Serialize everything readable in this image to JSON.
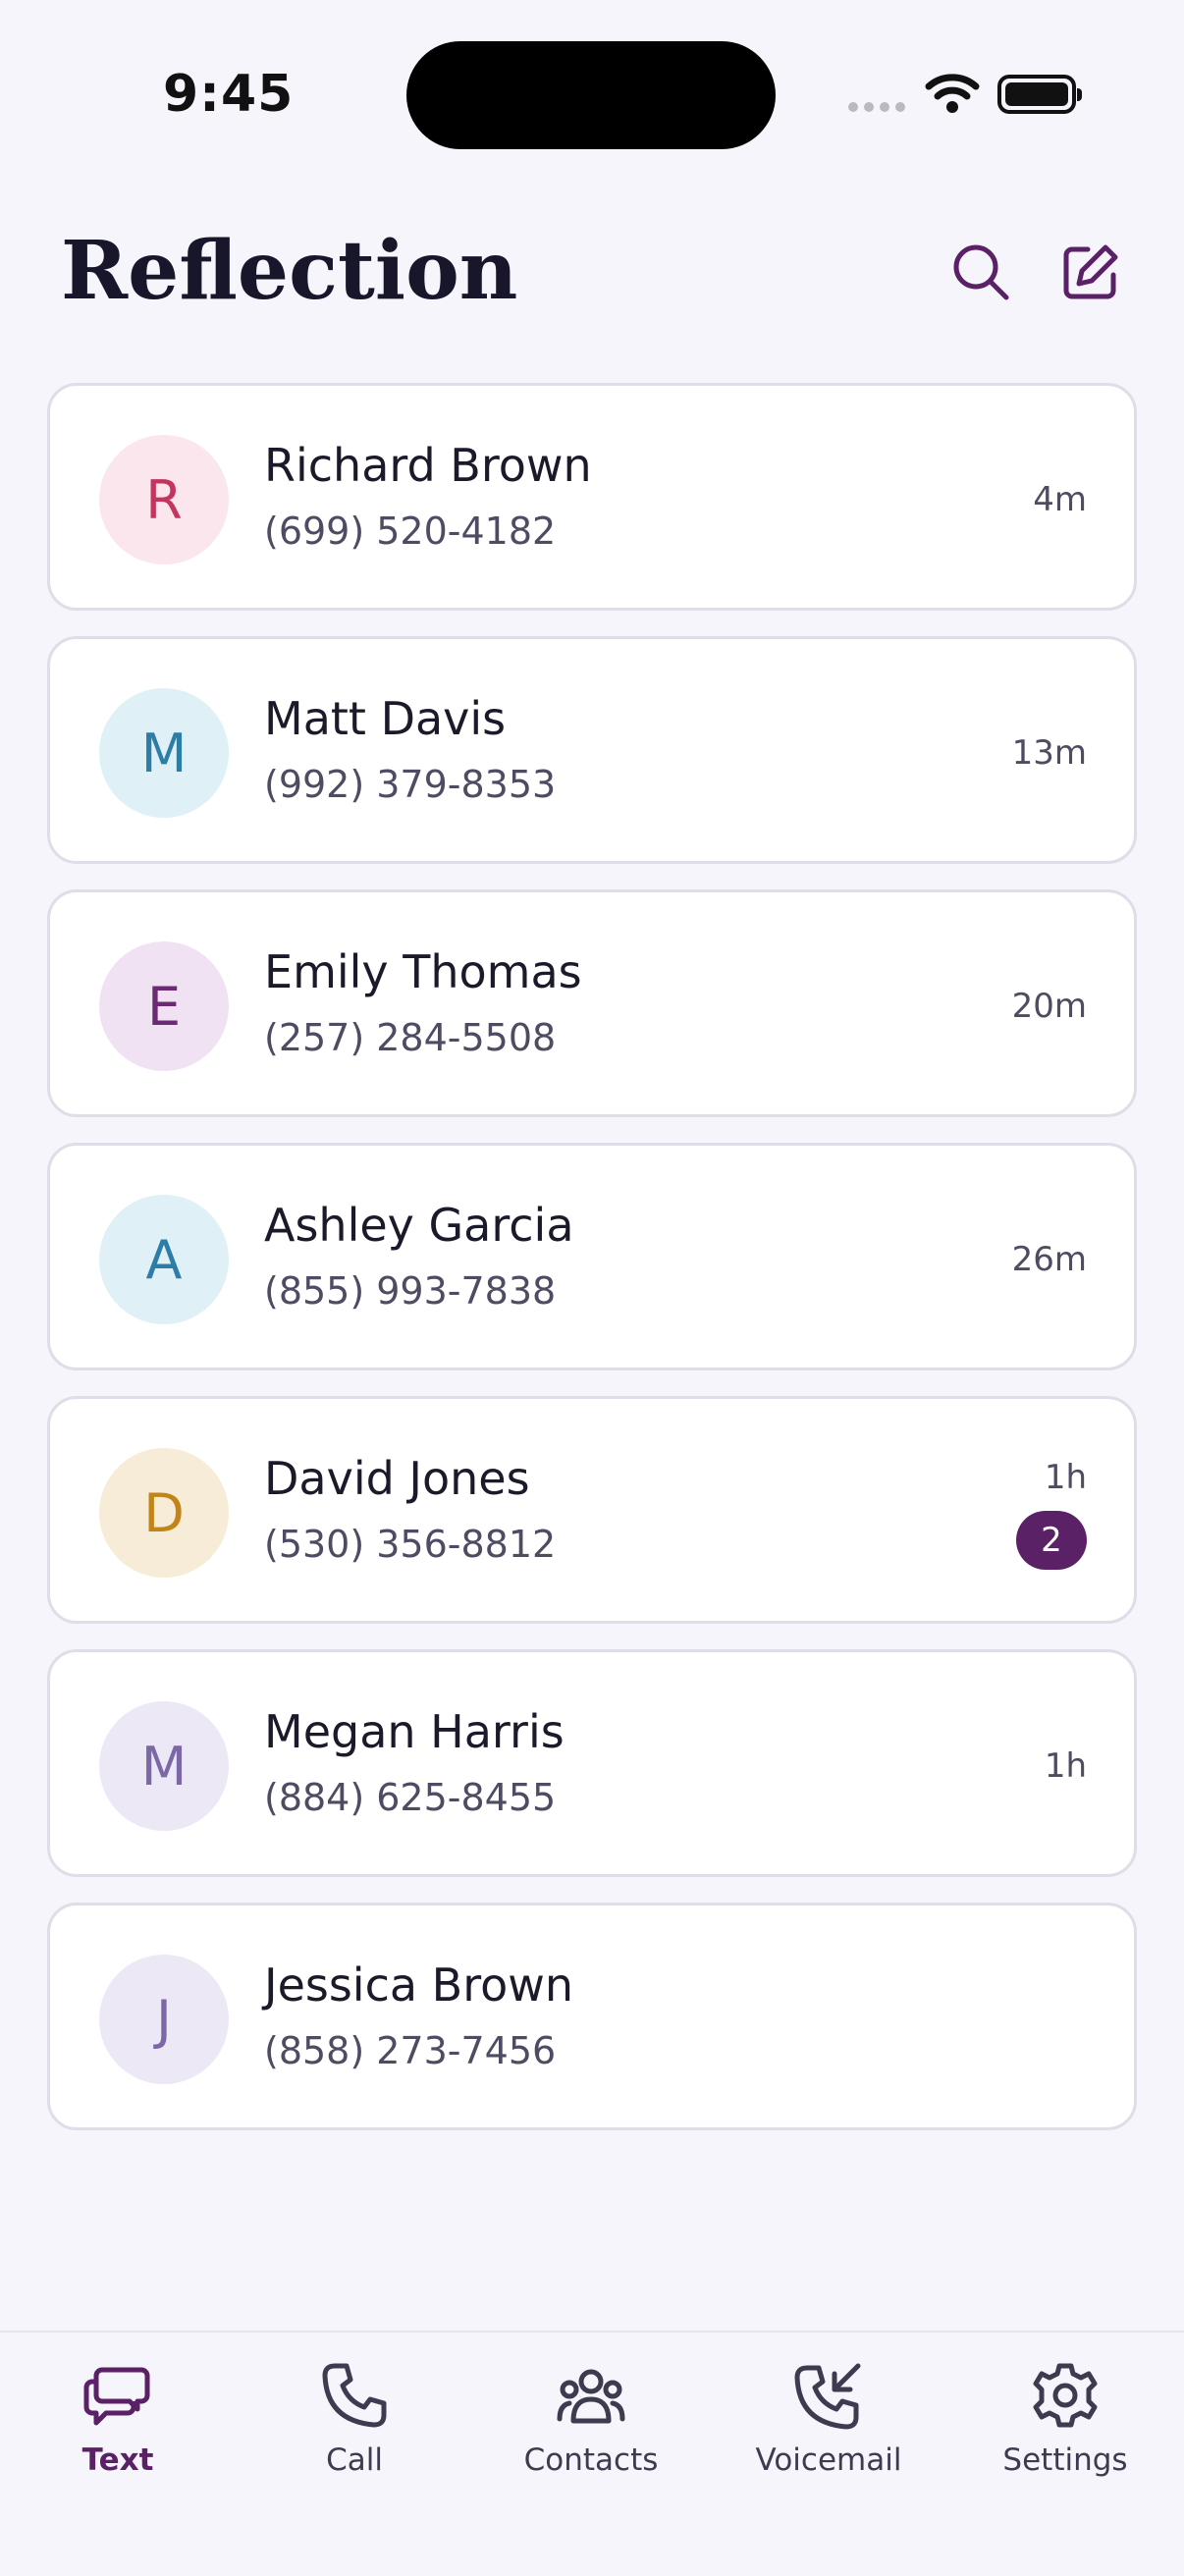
{
  "status": {
    "time": "9:45"
  },
  "header": {
    "title": "Reflection"
  },
  "conversations": [
    {
      "initial": "R",
      "name": "Richard Brown",
      "phone": "(699) 520-4182",
      "time": "4m",
      "badge": null,
      "avatar_bg": "#fbe6ee",
      "avatar_fg": "#c2355f"
    },
    {
      "initial": "M",
      "name": "Matt Davis",
      "phone": "(992) 379-8353",
      "time": "13m",
      "badge": null,
      "avatar_bg": "#dff0f6",
      "avatar_fg": "#2d7ea6"
    },
    {
      "initial": "E",
      "name": "Emily Thomas",
      "phone": "(257) 284-5508",
      "time": "20m",
      "badge": null,
      "avatar_bg": "#f1e2f3",
      "avatar_fg": "#6d2a74"
    },
    {
      "initial": "A",
      "name": "Ashley Garcia",
      "phone": "(855) 993-7838",
      "time": "26m",
      "badge": null,
      "avatar_bg": "#dff0f6",
      "avatar_fg": "#2d7ea6"
    },
    {
      "initial": "D",
      "name": "David Jones",
      "phone": "(530) 356-8812",
      "time": "1h",
      "badge": "2",
      "avatar_bg": "#f6ecd8",
      "avatar_fg": "#c28417"
    },
    {
      "initial": "M",
      "name": "Megan Harris",
      "phone": "(884) 625-8455",
      "time": "1h",
      "badge": null,
      "avatar_bg": "#ece8f5",
      "avatar_fg": "#7c68a6"
    },
    {
      "initial": "J",
      "name": "Jessica Brown",
      "phone": "(858) 273-7456",
      "time": "",
      "badge": null,
      "avatar_bg": "#ece8f5",
      "avatar_fg": "#7c68a6"
    }
  ],
  "tabs": [
    {
      "label": "Text",
      "icon": "chat-bubbles-icon",
      "active": true
    },
    {
      "label": "Call",
      "icon": "phone-icon",
      "active": false
    },
    {
      "label": "Contacts",
      "icon": "contacts-icon",
      "active": false
    },
    {
      "label": "Voicemail",
      "icon": "voicemail-incoming-icon",
      "active": false
    },
    {
      "label": "Settings",
      "icon": "gear-icon",
      "active": false
    }
  ],
  "colors": {
    "accent": "#5b2166",
    "background": "#f6f5fb",
    "card": "#ffffff"
  }
}
